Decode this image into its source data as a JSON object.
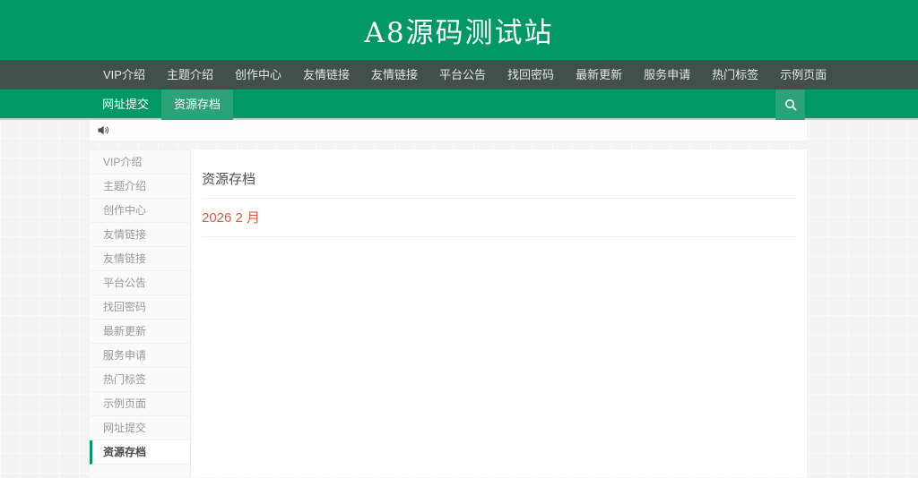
{
  "site": {
    "title": "A8源码测试站"
  },
  "colors": {
    "brand_green": "#009966",
    "nav_dark": "#434f4a",
    "active_teal": "#2ba277",
    "archive_link": "#df5940",
    "page_background": "#f3f3f4"
  },
  "main_nav": {
    "items": [
      "VIP介绍",
      "主题介绍",
      "创作中心",
      "友情链接",
      "友情链接",
      "平台公告",
      "找回密码",
      "最新更新",
      "服务申请",
      "热门标签",
      "示例页面"
    ]
  },
  "sub_nav": {
    "items": [
      {
        "label": "网址提交",
        "active": false
      },
      {
        "label": "资源存档",
        "active": true
      }
    ],
    "search_icon": "search-icon"
  },
  "announcement": {
    "icon": "speaker-icon"
  },
  "sidebar": {
    "items": [
      "VIP介绍",
      "主题介绍",
      "创作中心",
      "友情链接",
      "友情链接",
      "平台公告",
      "找回密码",
      "最新更新",
      "服务申请",
      "热门标签",
      "示例页面",
      "网址提交",
      "资源存档"
    ],
    "active_item": "资源存档"
  },
  "main": {
    "title": "资源存档",
    "archives": [
      {
        "label": "2026 2 月"
      }
    ]
  }
}
